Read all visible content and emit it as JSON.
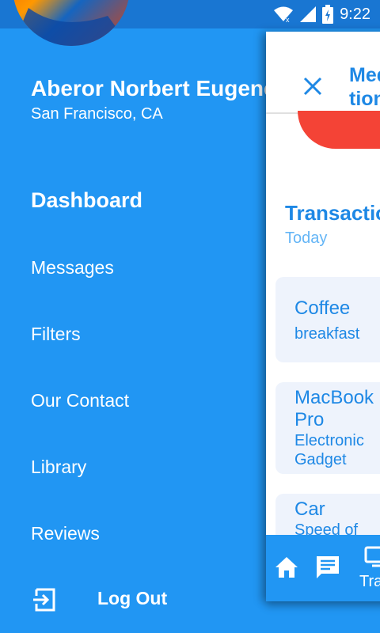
{
  "status_bar": {
    "time": "9:22",
    "icons": [
      "wifi-icon",
      "cell-signal-icon",
      "battery-charging-icon"
    ]
  },
  "drawer": {
    "avatar": "avatar-image",
    "user_name": "Aberor Norbert Eugene",
    "location": "San Francisco, CA",
    "menu": [
      {
        "label": "Dashboard",
        "active": true
      },
      {
        "label": "Messages"
      },
      {
        "label": "Filters"
      },
      {
        "label": "Our Contact"
      },
      {
        "label": "Library"
      },
      {
        "label": "Reviews"
      }
    ],
    "logout_label": "Log Out",
    "logout_icon": "logout-icon"
  },
  "panel": {
    "title": "Media tion",
    "title_line1": "Med",
    "title_line2": "tion",
    "section_title": "Transaction",
    "section_subtitle": "Today",
    "transactions": [
      {
        "title": "Coffee",
        "subtitle": "breakfast"
      },
      {
        "title_line1": "MacBook",
        "title_line2": "Pro",
        "subtitle_line1": "Electronic",
        "subtitle_line2": "Gadget"
      },
      {
        "title": "Car",
        "subtitle": "Speed of"
      }
    ],
    "bottom_nav": {
      "icons": [
        "home-icon",
        "chat-icon",
        "monitor-icon"
      ],
      "label": "Tra"
    }
  },
  "colors": {
    "primary": "#2196F3",
    "status": "#1976D2",
    "accent_red": "#F44336",
    "card_bg": "#EEF3FC"
  }
}
